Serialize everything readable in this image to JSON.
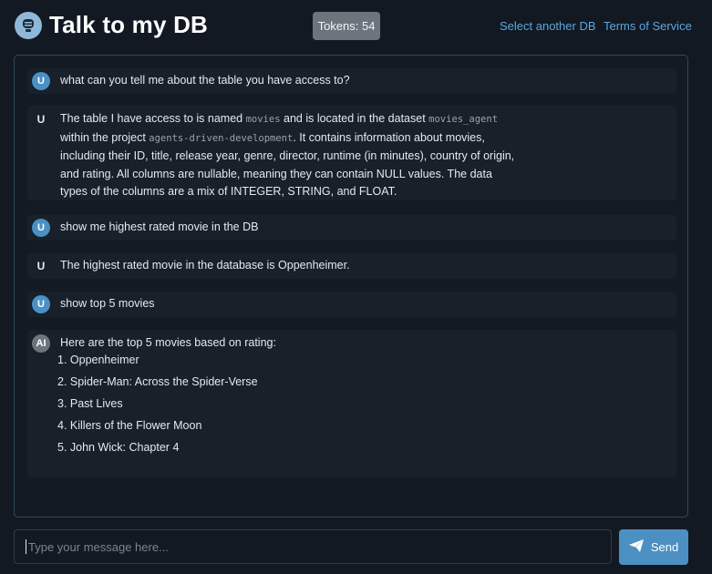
{
  "header": {
    "title": "Talk to my DB",
    "tokens_label": "Tokens: 54",
    "links": [
      "Select another DB",
      "Terms of Service"
    ]
  },
  "messages": [
    {
      "badge": "U",
      "text": "what can you tell me about the table you have access to?"
    },
    {
      "badge": "U",
      "lines": [
        [
          "The table I have access to is named ",
          "movies",
          " and is located in the dataset ",
          "movies_agent"
        ],
        [
          "within the project ",
          "agents-driven-development",
          ". It contains information about movies,"
        ],
        [
          "including their ID, title, release year, genre, director, runtime (in minutes), country of origin,"
        ],
        [
          "and rating. All columns are nullable, meaning they can contain NULL values. The data"
        ],
        [
          "types of the columns are a mix of INTEGER, STRING, and FLOAT."
        ]
      ]
    },
    {
      "badge": "U",
      "text": "show me highest rated movie in the DB"
    },
    {
      "badge": "U",
      "text": "The highest rated movie in the database is Oppenheimer."
    },
    {
      "badge": "U",
      "text": "show top 5 movies"
    },
    {
      "badge": "AI",
      "intro": "Here are the top 5 movies based on rating:",
      "list": [
        "1. Oppenheimer",
        "2. Spider-Man: Across the Spider-Verse",
        "3. Past Lives",
        "4. Killers of the Flower Moon",
        "5. John Wick: Chapter 4"
      ]
    }
  ],
  "composer": {
    "placeholder": "Type your message here...",
    "send_label": "Send"
  },
  "icons": {
    "logo": "chat-bot-icon",
    "send": "paper-plane-icon"
  },
  "colors": {
    "accent": "#4c8fc2",
    "link": "#5ba6e0",
    "background": "#121922"
  }
}
